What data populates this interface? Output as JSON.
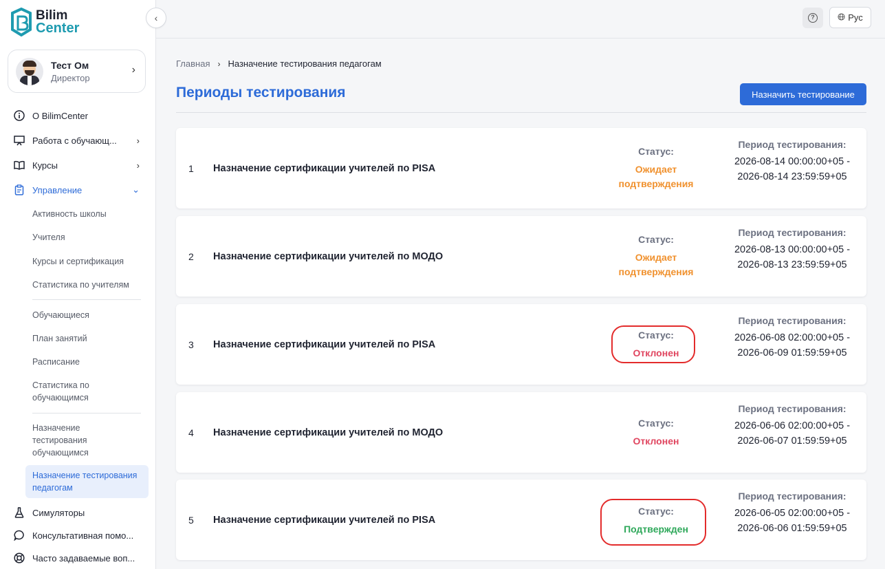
{
  "logo": {
    "line1": "Bilim",
    "line2": "Center"
  },
  "user": {
    "name": "Тест Ом",
    "role": "Директор"
  },
  "nav": {
    "about": "О BilimCenter",
    "students_work": "Работа с обучающ...",
    "courses": "Курсы",
    "management": "Управление",
    "sub": {
      "school_activity": "Активность школы",
      "teachers": "Учителя",
      "courses_cert": "Курсы и сертификация",
      "teacher_stats": "Статистика по учителям",
      "students": "Обучающиеся",
      "lesson_plan": "План занятий",
      "schedule": "Расписание",
      "student_stats": "Статистика по обучающимся",
      "student_testing": "Назначение тестирования обучающимся",
      "teacher_testing": "Назначение тестирования педагогам"
    },
    "simulators": "Симуляторы",
    "consult": "Консультативная помо...",
    "faq": "Часто задаваемые воп..."
  },
  "topbar": {
    "lang": "Рус"
  },
  "breadcrumb": {
    "home": "Главная",
    "current": "Назначение тестирования педагогам"
  },
  "page": {
    "title": "Периоды тестирования",
    "assign_button": "Назначить тестирование"
  },
  "labels": {
    "status": "Статус:",
    "period": "Период тестирования:"
  },
  "periods": [
    {
      "num": "1",
      "name": "Назначение сертификации учителей по PISA",
      "status": "Ожидает подтверждения",
      "period": "2026-08-14 00:00:00+05 - 2026-08-14 23:59:59+05"
    },
    {
      "num": "2",
      "name": "Назначение сертификации учителей по МОДО",
      "status": "Ожидает подтверждения",
      "period": "2026-08-13 00:00:00+05 - 2026-08-13 23:59:59+05"
    },
    {
      "num": "3",
      "name": "Назначение сертификации учителей по PISA",
      "status": "Отклонен",
      "period": "2026-06-08 02:00:00+05 - 2026-06-09 01:59:59+05"
    },
    {
      "num": "4",
      "name": "Назначение сертификации учителей по МОДО",
      "status": "Отклонен",
      "period": "2026-06-06 02:00:00+05 - 2026-06-07 01:59:59+05"
    },
    {
      "num": "5",
      "name": "Назначение сертификации учителей по PISA",
      "status": "Подтвержден",
      "period": "2026-06-05 02:00:00+05 - 2026-06-06 01:59:59+05"
    }
  ],
  "colors": {
    "accent": "#2d6bd8",
    "pending": "#f0912e",
    "rejected": "#e0455f",
    "approved": "#2ea85a",
    "highlight": "#e32b2b"
  },
  "icons": {
    "logo": "bilim-center-logo-icon",
    "collapse": "chevron-left-icon",
    "about": "info-icon",
    "students_work": "presentation-board-icon",
    "courses": "book-icon",
    "management": "clipboard-icon",
    "simulators": "flask-icon",
    "consult": "chat-bubble-icon",
    "faq": "lifebuoy-icon",
    "help": "question-circle-icon",
    "lang": "globe-icon"
  }
}
